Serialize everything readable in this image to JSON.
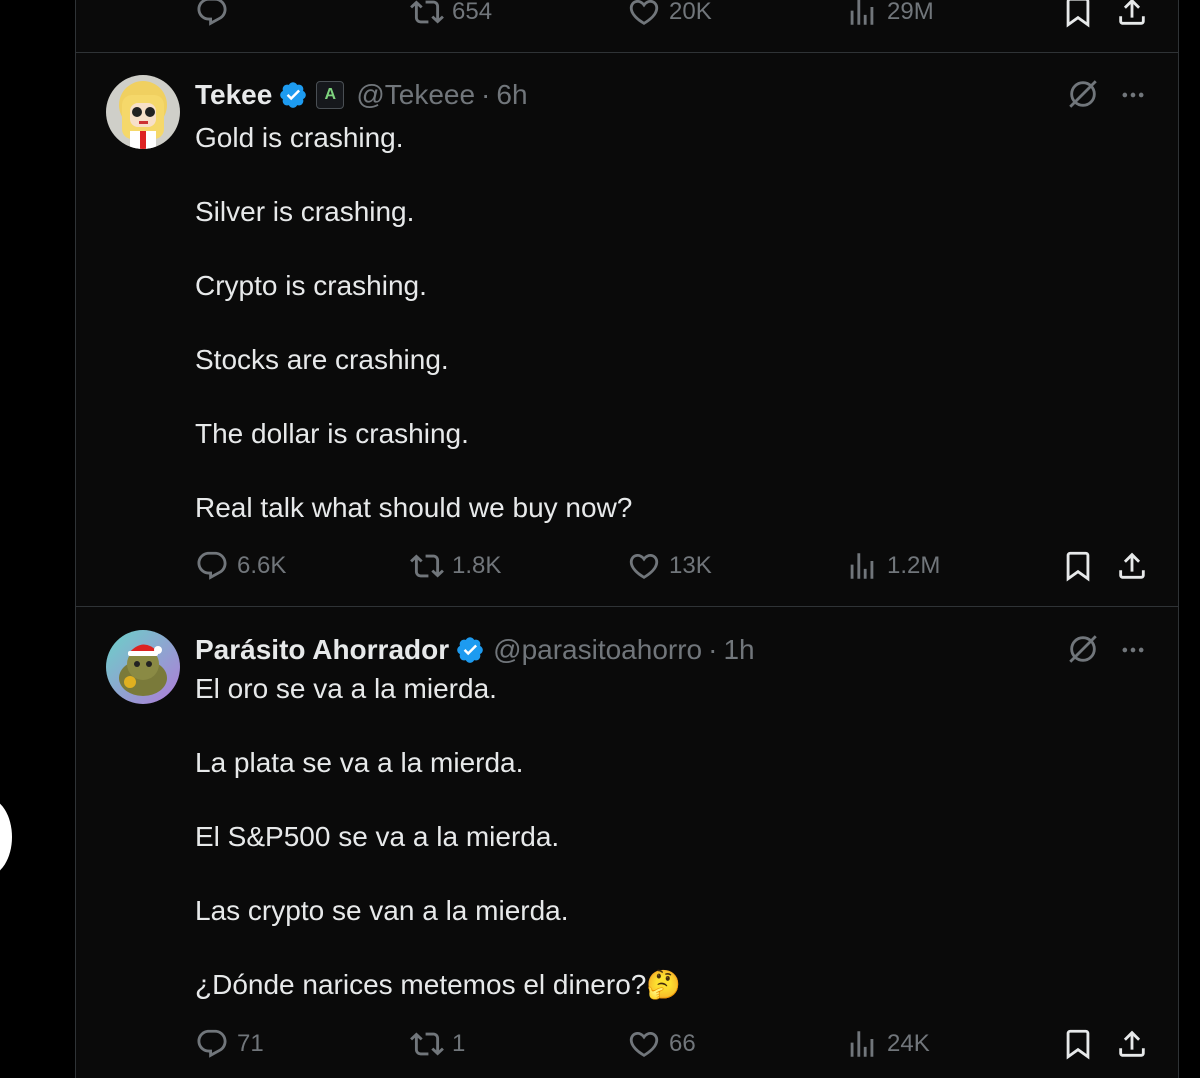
{
  "previous_tweet_actions": {
    "reply": "",
    "retweets": "654",
    "likes": "20K",
    "views": "29M"
  },
  "tweets": [
    {
      "name": "Tekee",
      "affiliate_badge": "A",
      "handle": "@Tekeee",
      "time": "6h",
      "lines": [
        "Gold is crashing.",
        "Silver is crashing.",
        "Crypto is crashing.",
        "Stocks are crashing.",
        "The dollar is crashing.",
        "Real talk what should we buy now?"
      ],
      "replies": "6.6K",
      "retweets": "1.8K",
      "likes": "13K",
      "views": "1.2M"
    },
    {
      "name": "Parásito Ahorrador",
      "handle": "@parasitoahorro",
      "time": "1h",
      "lines": [
        "El oro se va a la mierda.",
        "La plata se va a la mierda.",
        "El S&P500 se va a la mierda.",
        "Las crypto se van a la mierda.",
        "¿Dónde narices metemos el dinero?🤔"
      ],
      "replies": "71",
      "retweets": "1",
      "likes": "66",
      "views": "24K"
    }
  ],
  "colors": {
    "background": "#000000",
    "text": "#e7e9ea",
    "muted": "#71767b",
    "verified": "#1d9bf0",
    "divider": "#2f3336"
  },
  "icons": [
    "reply-icon",
    "retweet-icon",
    "like-icon",
    "views-icon",
    "bookmark-icon",
    "share-icon",
    "grok-icon",
    "more-icon",
    "verified-icon"
  ]
}
